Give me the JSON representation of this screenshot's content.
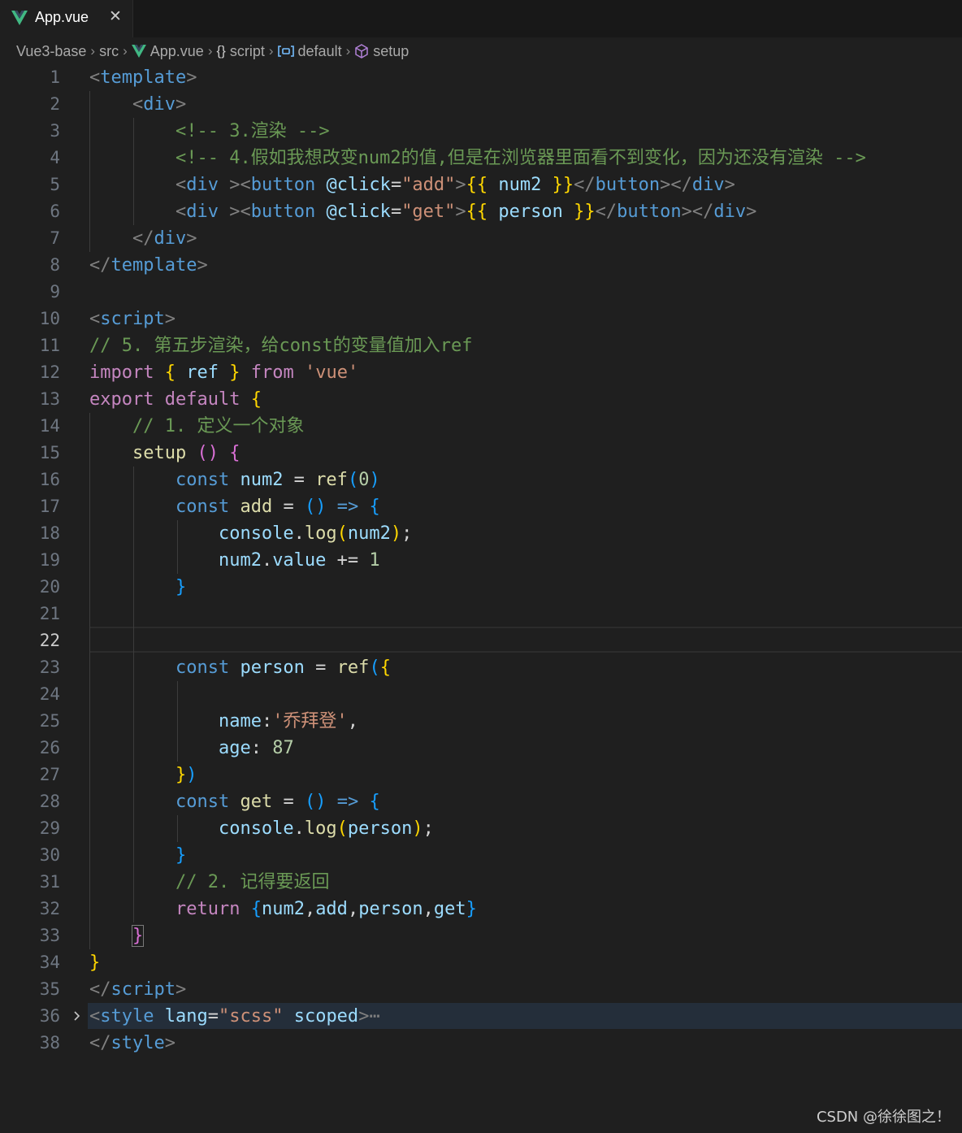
{
  "tab": {
    "title": "App.vue",
    "close": "✕"
  },
  "breadcrumb": {
    "items": [
      "Vue3-base",
      "src",
      "App.vue",
      "script",
      "default",
      "setup"
    ],
    "braces": "{}"
  },
  "editor": {
    "active_line": "22",
    "folded_line": "36",
    "line_numbers": [
      "1",
      "2",
      "3",
      "4",
      "5",
      "6",
      "7",
      "8",
      "9",
      "10",
      "11",
      "12",
      "13",
      "14",
      "15",
      "16",
      "17",
      "18",
      "19",
      "20",
      "21",
      "22",
      "23",
      "24",
      "25",
      "26",
      "27",
      "28",
      "29",
      "30",
      "31",
      "32",
      "33",
      "34",
      "35",
      "36",
      "38"
    ],
    "lines": [
      [
        [
          "pu",
          "<"
        ],
        [
          "tg",
          "template"
        ],
        [
          "pu",
          ">"
        ]
      ],
      [
        [
          "tx",
          "    "
        ],
        [
          "pu",
          "<"
        ],
        [
          "tg",
          "div"
        ],
        [
          "pu",
          ">"
        ]
      ],
      [
        [
          "tx",
          "        "
        ],
        [
          "cm",
          "<!-- 3.渲染 -->"
        ]
      ],
      [
        [
          "tx",
          "        "
        ],
        [
          "cm",
          "<!-- 4.假如我想改变num2的值,但是在浏览器里面看不到变化，因为还没有渲染 -->"
        ]
      ],
      [
        [
          "tx",
          "        "
        ],
        [
          "pu",
          "<"
        ],
        [
          "tg",
          "div"
        ],
        [
          "tx",
          " "
        ],
        [
          "pu",
          "><"
        ],
        [
          "tg",
          "button"
        ],
        [
          "tx",
          " "
        ],
        [
          "at",
          "@click"
        ],
        [
          "tx",
          "="
        ],
        [
          "st",
          "\"add\""
        ],
        [
          "pu",
          ">"
        ],
        [
          "b1",
          "{{"
        ],
        [
          "tx",
          " "
        ],
        [
          "vr",
          "num2"
        ],
        [
          "tx",
          " "
        ],
        [
          "b1",
          "}}"
        ],
        [
          "pu",
          "</"
        ],
        [
          "tg",
          "button"
        ],
        [
          "pu",
          "></"
        ],
        [
          "tg",
          "div"
        ],
        [
          "pu",
          ">"
        ]
      ],
      [
        [
          "tx",
          "        "
        ],
        [
          "pu",
          "<"
        ],
        [
          "tg",
          "div"
        ],
        [
          "tx",
          " "
        ],
        [
          "pu",
          "><"
        ],
        [
          "tg",
          "button"
        ],
        [
          "tx",
          " "
        ],
        [
          "at",
          "@click"
        ],
        [
          "tx",
          "="
        ],
        [
          "st",
          "\"get\""
        ],
        [
          "pu",
          ">"
        ],
        [
          "b1",
          "{{"
        ],
        [
          "tx",
          " "
        ],
        [
          "vr",
          "person"
        ],
        [
          "tx",
          " "
        ],
        [
          "b1",
          "}}"
        ],
        [
          "pu",
          "</"
        ],
        [
          "tg",
          "button"
        ],
        [
          "pu",
          "></"
        ],
        [
          "tg",
          "div"
        ],
        [
          "pu",
          ">"
        ]
      ],
      [
        [
          "tx",
          "    "
        ],
        [
          "pu",
          "</"
        ],
        [
          "tg",
          "div"
        ],
        [
          "pu",
          ">"
        ]
      ],
      [
        [
          "pu",
          "</"
        ],
        [
          "tg",
          "template"
        ],
        [
          "pu",
          ">"
        ]
      ],
      [
        [
          "tx",
          ""
        ]
      ],
      [
        [
          "pu",
          "<"
        ],
        [
          "tg",
          "script"
        ],
        [
          "pu",
          ">"
        ]
      ],
      [
        [
          "cm",
          "// 5. 第五步渲染，给const的变量值加入ref"
        ]
      ],
      [
        [
          "kw",
          "import"
        ],
        [
          "tx",
          " "
        ],
        [
          "b1",
          "{"
        ],
        [
          "tx",
          " "
        ],
        [
          "vr",
          "ref"
        ],
        [
          "tx",
          " "
        ],
        [
          "b1",
          "}"
        ],
        [
          "tx",
          " "
        ],
        [
          "kw",
          "from"
        ],
        [
          "tx",
          " "
        ],
        [
          "st",
          "'vue'"
        ]
      ],
      [
        [
          "kw",
          "export"
        ],
        [
          "tx",
          " "
        ],
        [
          "kw",
          "default"
        ],
        [
          "tx",
          " "
        ],
        [
          "b1",
          "{"
        ]
      ],
      [
        [
          "tx",
          "    "
        ],
        [
          "cm",
          "// 1. 定义一个对象"
        ]
      ],
      [
        [
          "tx",
          "    "
        ],
        [
          "fn",
          "setup"
        ],
        [
          "tx",
          " "
        ],
        [
          "b2",
          "()"
        ],
        [
          "tx",
          " "
        ],
        [
          "b2",
          "{"
        ]
      ],
      [
        [
          "tx",
          "        "
        ],
        [
          "dk",
          "const"
        ],
        [
          "tx",
          " "
        ],
        [
          "vr",
          "num2"
        ],
        [
          "tx",
          " = "
        ],
        [
          "fn",
          "ref"
        ],
        [
          "b3",
          "("
        ],
        [
          "nm",
          "0"
        ],
        [
          "b3",
          ")"
        ]
      ],
      [
        [
          "tx",
          "        "
        ],
        [
          "dk",
          "const"
        ],
        [
          "tx",
          " "
        ],
        [
          "fn",
          "add"
        ],
        [
          "tx",
          " = "
        ],
        [
          "b3",
          "()"
        ],
        [
          "tx",
          " "
        ],
        [
          "dk",
          "=>"
        ],
        [
          "tx",
          " "
        ],
        [
          "b3",
          "{"
        ]
      ],
      [
        [
          "tx",
          "            "
        ],
        [
          "vr",
          "console"
        ],
        [
          "tx",
          "."
        ],
        [
          "fn",
          "log"
        ],
        [
          "b1",
          "("
        ],
        [
          "vr",
          "num2"
        ],
        [
          "b1",
          ")"
        ],
        [
          "tx",
          ";"
        ]
      ],
      [
        [
          "tx",
          "            "
        ],
        [
          "vr",
          "num2"
        ],
        [
          "tx",
          "."
        ],
        [
          "vr",
          "value"
        ],
        [
          "tx",
          " += "
        ],
        [
          "nm",
          "1"
        ]
      ],
      [
        [
          "tx",
          "        "
        ],
        [
          "b3",
          "}"
        ]
      ],
      [
        [
          "tx",
          ""
        ]
      ],
      [
        [
          "tx",
          ""
        ]
      ],
      [
        [
          "tx",
          "        "
        ],
        [
          "dk",
          "const"
        ],
        [
          "tx",
          " "
        ],
        [
          "vr",
          "person"
        ],
        [
          "tx",
          " = "
        ],
        [
          "fn",
          "ref"
        ],
        [
          "b3",
          "("
        ],
        [
          "b1",
          "{"
        ]
      ],
      [
        [
          "tx",
          ""
        ]
      ],
      [
        [
          "tx",
          "            "
        ],
        [
          "vr",
          "name"
        ],
        [
          "tx",
          ":"
        ],
        [
          "st",
          "'乔拜登'"
        ],
        [
          "tx",
          ","
        ]
      ],
      [
        [
          "tx",
          "            "
        ],
        [
          "vr",
          "age"
        ],
        [
          "tx",
          ": "
        ],
        [
          "nm",
          "87"
        ]
      ],
      [
        [
          "tx",
          "        "
        ],
        [
          "b1",
          "}"
        ],
        [
          "b3",
          ")"
        ]
      ],
      [
        [
          "tx",
          "        "
        ],
        [
          "dk",
          "const"
        ],
        [
          "tx",
          " "
        ],
        [
          "fn",
          "get"
        ],
        [
          "tx",
          " = "
        ],
        [
          "b3",
          "()"
        ],
        [
          "tx",
          " "
        ],
        [
          "dk",
          "=>"
        ],
        [
          "tx",
          " "
        ],
        [
          "b3",
          "{"
        ]
      ],
      [
        [
          "tx",
          "            "
        ],
        [
          "vr",
          "console"
        ],
        [
          "tx",
          "."
        ],
        [
          "fn",
          "log"
        ],
        [
          "b1",
          "("
        ],
        [
          "vr",
          "person"
        ],
        [
          "b1",
          ")"
        ],
        [
          "tx",
          ";"
        ]
      ],
      [
        [
          "tx",
          "        "
        ],
        [
          "b3",
          "}"
        ]
      ],
      [
        [
          "tx",
          "        "
        ],
        [
          "cm",
          "// 2. 记得要返回"
        ]
      ],
      [
        [
          "tx",
          "        "
        ],
        [
          "kw",
          "return"
        ],
        [
          "tx",
          " "
        ],
        [
          "b3",
          "{"
        ],
        [
          "vr",
          "num2"
        ],
        [
          "tx",
          ","
        ],
        [
          "vr",
          "add"
        ],
        [
          "tx",
          ","
        ],
        [
          "vr",
          "person"
        ],
        [
          "tx",
          ","
        ],
        [
          "vr",
          "get"
        ],
        [
          "b3",
          "}"
        ]
      ],
      [
        [
          "tx",
          "    "
        ],
        [
          "b2bm",
          "}"
        ]
      ],
      [
        [
          "b1",
          "}"
        ]
      ],
      [
        [
          "pu",
          "</"
        ],
        [
          "tg",
          "script"
        ],
        [
          "pu",
          ">"
        ]
      ],
      [
        [
          "pu",
          "<"
        ],
        [
          "tg",
          "style"
        ],
        [
          "tx",
          " "
        ],
        [
          "at",
          "lang"
        ],
        [
          "tx",
          "="
        ],
        [
          "st",
          "\"scss\""
        ],
        [
          "tx",
          " "
        ],
        [
          "at",
          "scoped"
        ],
        [
          "pu",
          ">"
        ],
        [
          "pu",
          "⋯"
        ]
      ],
      [
        [
          "pu",
          "</"
        ],
        [
          "tg",
          "style"
        ],
        [
          "pu",
          ">"
        ]
      ]
    ]
  },
  "watermark": "CSDN @徐徐图之！",
  "colors": {
    "background": "#1f1f1f",
    "tag": "#569cd6",
    "comment": "#6a9955",
    "string": "#ce9178",
    "keyword": "#c586c0",
    "bracket_gold": "#ffd700"
  }
}
